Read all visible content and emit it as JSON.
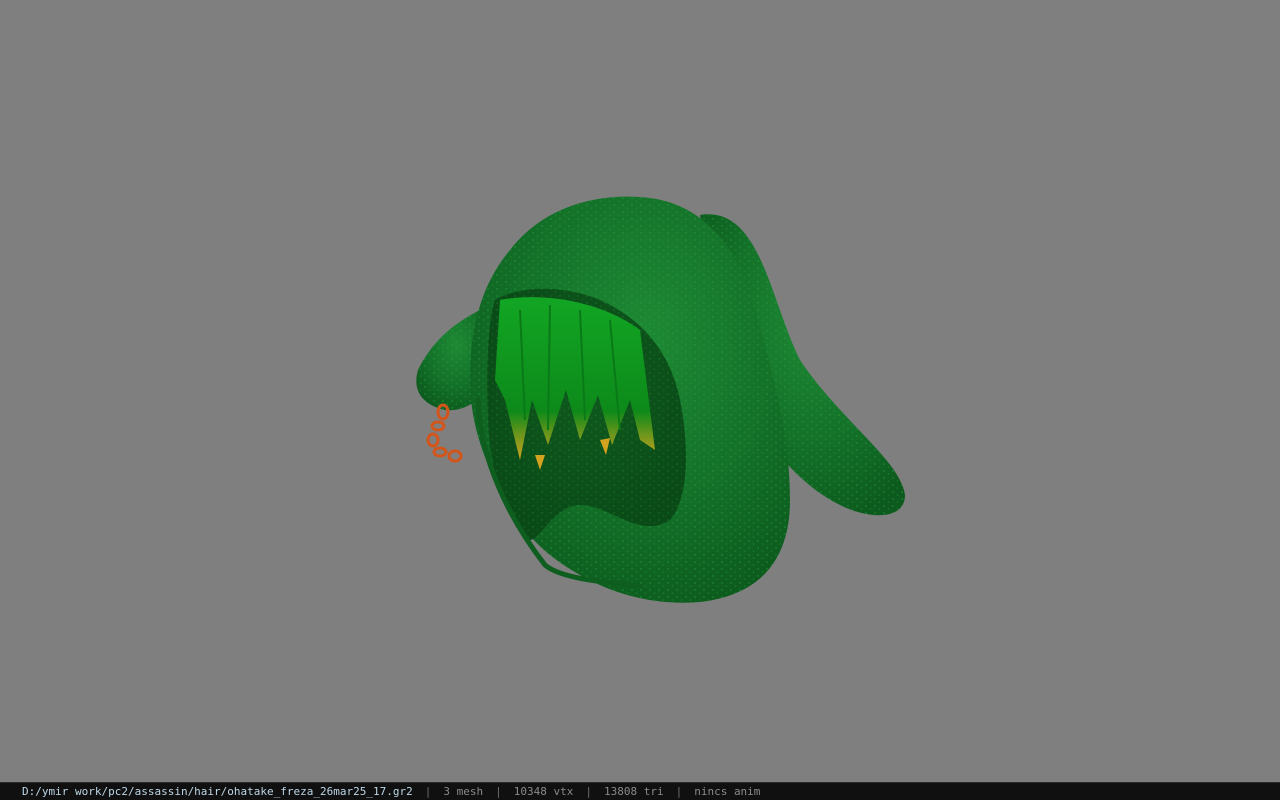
{
  "viewport": {
    "background_color": "#7f7f7f",
    "model": {
      "hood_color": "#136b25",
      "hood_highlight": "#1f8a34",
      "hair_color": "#0f9a1e",
      "hair_tip_color": "#d0a11c",
      "chain_color": "#d2561b"
    }
  },
  "statusbar": {
    "file_path": "D:/ymir work/pc2/assassin/hair/ohatake_freza_26mar25_17.gr2",
    "separator": "|",
    "mesh_count": "3 mesh",
    "vertex_count": "10348 vtx",
    "triangle_count": "13808 tri",
    "anim_status": "nincs anim"
  }
}
